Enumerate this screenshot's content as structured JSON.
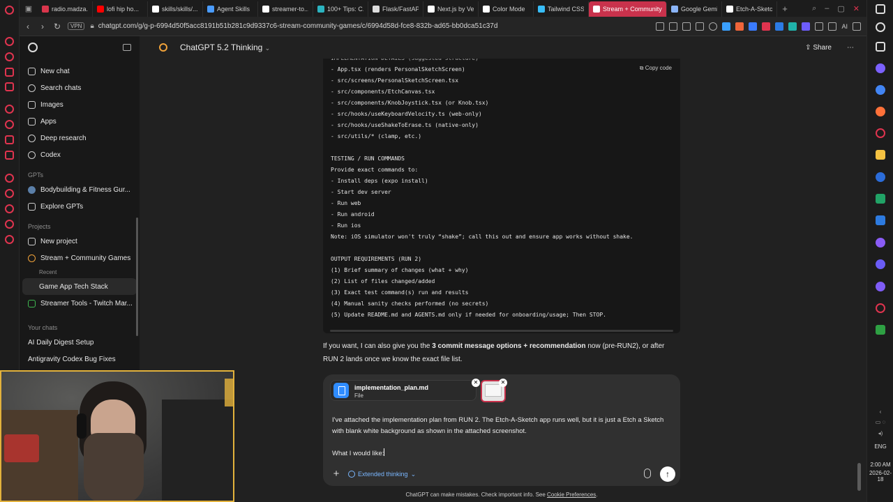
{
  "tabs": [
    {
      "label": "radio.madza...",
      "color": "#d9364c"
    },
    {
      "label": "lofi hip ho...",
      "color": "#ff0000"
    },
    {
      "label": "skills/skills/...",
      "color": "#ffffff"
    },
    {
      "label": "Agent Skills",
      "color": "#4a9cff"
    },
    {
      "label": "streamer-to...",
      "color": "#ffffff"
    },
    {
      "label": "100+ Tips: C...",
      "color": "#2bb3c0"
    },
    {
      "label": "Flask/FastAP...",
      "color": "#dddddd"
    },
    {
      "label": "Next.js by Ve...",
      "color": "#ffffff"
    },
    {
      "label": "Color Mode",
      "color": "#ffffff"
    },
    {
      "label": "Tailwind CSS",
      "color": "#38bdf8"
    },
    {
      "label": "Stream + Community G...",
      "color": "#ffffff",
      "active": true
    },
    {
      "label": "Google Gemi...",
      "color": "#8ab4f8"
    },
    {
      "label": "Etch-A-Sketc...",
      "color": "#ffffff"
    }
  ],
  "address": {
    "vpn": "VPN",
    "url": "chatgpt.com/g/g-p-6994d50f5acc8191b51b281c9d9337c6-stream-community-games/c/6994d58d-fce8-832b-ad65-bb0dca51c37d",
    "ai_label": "AI"
  },
  "sidebar": {
    "items": [
      {
        "label": "New chat",
        "icon": "edit-icon"
      },
      {
        "label": "Search chats",
        "icon": "search-icon"
      },
      {
        "label": "Images",
        "icon": "image-icon"
      },
      {
        "label": "Apps",
        "icon": "apps-icon"
      },
      {
        "label": "Deep research",
        "icon": "telescope-icon"
      },
      {
        "label": "Codex",
        "icon": "codex-icon"
      }
    ],
    "gpts_header": "GPTs",
    "gpts": [
      {
        "label": "Bodybuilding & Fitness Gur...",
        "icon": "gpt-avatar-icon"
      },
      {
        "label": "Explore GPTs",
        "icon": "grid-icon"
      }
    ],
    "projects_header": "Projects",
    "projects": [
      {
        "label": "New project",
        "icon": "folder-plus-icon"
      },
      {
        "label": "Stream + Community Games",
        "icon": "globe-icon"
      }
    ],
    "recent_header": "Recent",
    "recent": [
      {
        "label": "Game App Tech Stack"
      },
      {
        "label": "Streamer Tools - Twitch Mar...",
        "icon": "flask-icon"
      }
    ],
    "chats_header": "Your chats",
    "chats": [
      {
        "label": "AI Daily Digest Setup"
      },
      {
        "label": "Antigravity Codex Bug Fixes"
      }
    ]
  },
  "header": {
    "title": "ChatGPT 5.2 Thinking",
    "share": "Share"
  },
  "code": {
    "copy_label": "Copy code",
    "lines": [
      "IMPLEMENTATION DETAILS (suggested structure)",
      "- App.tsx (renders PersonalSketchScreen)",
      "- src/screens/PersonalSketchScreen.tsx",
      "- src/components/EtchCanvas.tsx",
      "- src/components/KnobJoystick.tsx (or Knob.tsx)",
      "- src/hooks/useKeyboardVelocity.ts (web-only)",
      "- src/hooks/useShakeToErase.ts (native-only)",
      "- src/utils/* (clamp, etc.)",
      "",
      "TESTING / RUN COMMANDS",
      "Provide exact commands to:",
      "- Install deps (expo install)",
      "- Start dev server",
      "- Run web",
      "- Run android",
      "- Run ios",
      "Note: iOS simulator won't truly “shake”; call this out and ensure app works without shake.",
      "",
      "OUTPUT REQUIREMENTS (RUN 2)",
      "(1) Brief summary of changes (what + why)",
      "(2) List of files changed/added",
      "(3) Exact test command(s) run and results",
      "(4) Manual sanity checks performed (no secrets)",
      "(5) Update README.md and AGENTS.md only if needed for onboarding/usage; Then STOP."
    ]
  },
  "message": {
    "before": "If you want, I can also give you the ",
    "bold": "3 commit message options + recommendation",
    "after": " now (pre-RUN2), or after RUN 2 lands once we know the exact file list."
  },
  "composer": {
    "attachment_name": "implementation_plan.md",
    "attachment_type": "File",
    "prompt_p1": "I've attached the implementation plan from RUN 2. The Etch-A-Sketch app runs well, but it is just a Etch a Sketch with blank white background as shown in the attached screenshot.",
    "prompt_p2": "What I would like:",
    "extended": "Extended thinking"
  },
  "footer": {
    "text": "ChatGPT can make mistakes. Check important info. See ",
    "link": "Cookie Preferences",
    "end": "."
  },
  "system": {
    "lang": "ENG",
    "time": "2:00 AM",
    "date": "2026-02-18"
  }
}
